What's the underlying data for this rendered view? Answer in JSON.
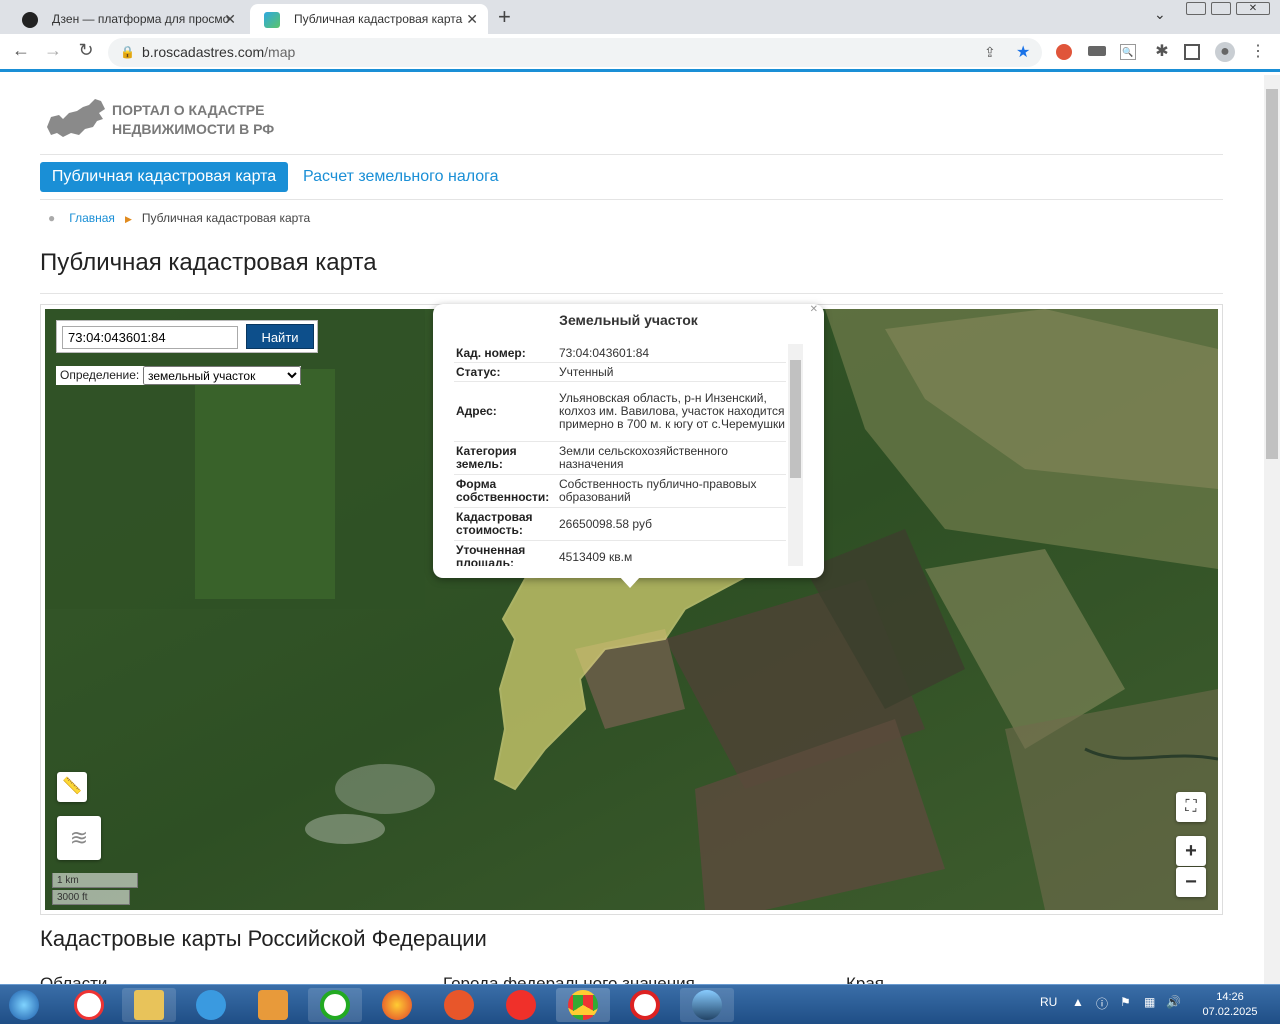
{
  "browser": {
    "tabs": [
      {
        "label": "Дзен — платформа для просмо",
        "active": false
      },
      {
        "label": "Публичная кадастровая карта",
        "active": true
      }
    ],
    "url_host": "b.roscadastres.com",
    "url_path": "/map"
  },
  "header": {
    "logo_line1": "ПОРТАЛ О КАДАСТРЕ",
    "logo_line2": "НЕДВИЖИМОСТИ В РФ"
  },
  "nav": {
    "active_label": "Публичная кадастровая карта",
    "link_label": "Расчет земельного налога"
  },
  "breadcrumb": {
    "home": "Главная",
    "current": "Публичная кадастровая карта"
  },
  "page_title": "Публичная кадастровая карта",
  "map": {
    "search_value": "73:04:043601:84",
    "find_label": "Найти",
    "definition_label": "Определение:",
    "definition_value": "земельный участок",
    "scale_km": "1 km",
    "scale_ft": "3000 ft",
    "zoom_in": "+",
    "zoom_out": "−"
  },
  "popup": {
    "title": "Земельный участок",
    "rows": [
      {
        "key": "Кад. номер:",
        "value": "73:04:043601:84"
      },
      {
        "key": "Статус:",
        "value": "Учтенный"
      },
      {
        "key": "Адрес:",
        "value": "Ульяновская область, р-н Инзенский, колхоз им. Вавилова, участок находится примерно в 700 м. к югу от с.Черемушки"
      },
      {
        "key": "Категория земель:",
        "value": "Земли сельскохозяйственного назначения"
      },
      {
        "key": "Форма собственности:",
        "value": "Собственность публично-правовых образований"
      },
      {
        "key": "Кадастровая стоимость:",
        "value": "26650098.58 руб"
      },
      {
        "key": "Уточненная площадь:",
        "value": "4513409 кв.м"
      }
    ]
  },
  "sections": {
    "heading": "Кадастровые карты Российской Федерации",
    "col1": "Области",
    "col2": "Города федерального значения",
    "col3": "Края"
  },
  "taskbar": {
    "lang": "RU",
    "time": "14:26",
    "date": "07.02.2025"
  }
}
